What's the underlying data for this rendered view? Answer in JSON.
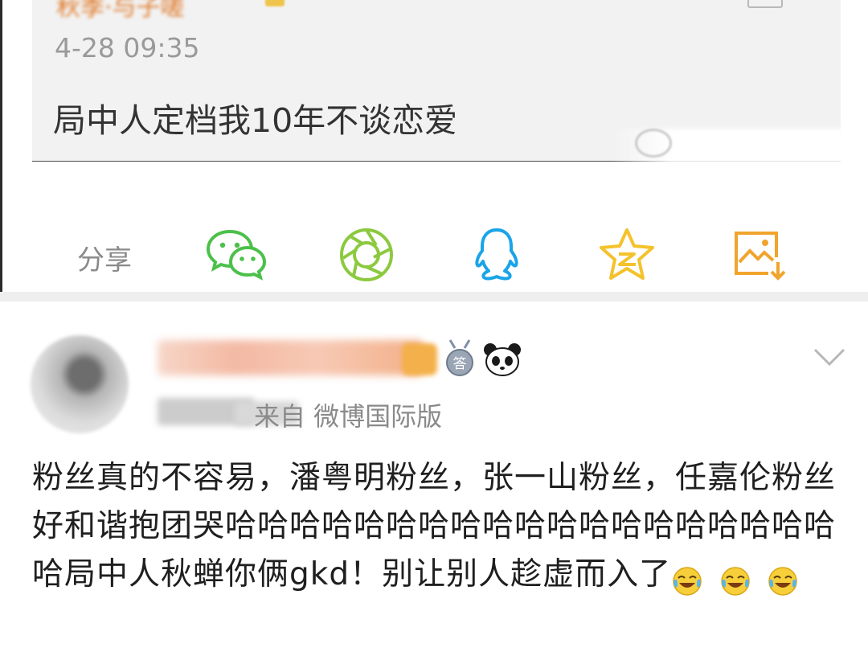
{
  "quote": {
    "author": "秋季·与子嗟",
    "time": "4-28 09:35",
    "text": "局中人定档我10年不谈恋爱"
  },
  "share": {
    "label": "分享",
    "icons": [
      "wechat-icon",
      "moments-icon",
      "qq-icon",
      "qzone-icon",
      "save-image-icon"
    ]
  },
  "comment": {
    "source": "来自 微博国际版",
    "text": "粉丝真的不容易，潘粤明粉丝，张一山粉丝，任嘉伦粉丝好和谐抱团哭哈哈哈哈哈哈哈哈哈哈哈哈哈哈哈哈哈哈哈哈局中人秋蝉你俩gkd！别让别人趁虚而入了",
    "emojis": [
      "laugh-cry-icon",
      "laugh-cry-icon",
      "laugh-cry-icon"
    ]
  },
  "colors": {
    "wechat_green": "#4bc04a",
    "moments_green": "#8cc93f",
    "qq_blue": "#1aa4e8",
    "qzone_yellow": "#f4c22b",
    "save_orange": "#f1a42c",
    "text_dark": "#1f1f1f",
    "text_gray": "#8a8a8a"
  }
}
